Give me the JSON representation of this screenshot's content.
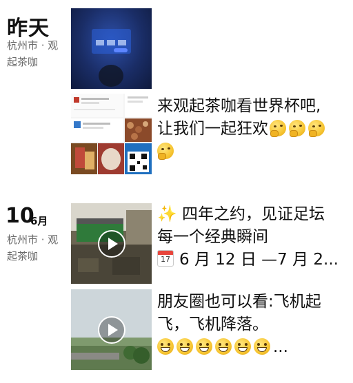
{
  "groups": [
    {
      "date_label": "昨天",
      "location_line1": "杭州市 · 观",
      "location_line2": "起茶咖",
      "posts": [
        {
          "text_line1": "来观起茶咖看世界杯吧,",
          "text_line2": "让我们一起狂欢",
          "emojis": [
            "thinking-face",
            "thinking-face",
            "thinking-face",
            "thinking-face"
          ]
        }
      ]
    },
    {
      "day": "10",
      "month": "6月",
      "location_line1": "杭州市 · 观",
      "location_line2": "起茶咖",
      "posts": [
        {
          "sparkle": "✨",
          "text_line1": "四年之约，见证足坛",
          "text_line2": "每一个经典瞬间",
          "calendar_day": "17",
          "text_line3": "6 月 12 日 —7 月 2..."
        },
        {
          "text_line1": "朋友圈也可以看:飞机起",
          "text_line2": "飞，飞机降落。",
          "emojis": [
            "grinning-face",
            "grinning-face",
            "grinning-face",
            "grinning-face",
            "grinning-face",
            "grinning-face"
          ],
          "ellipsis": "..."
        }
      ]
    }
  ]
}
